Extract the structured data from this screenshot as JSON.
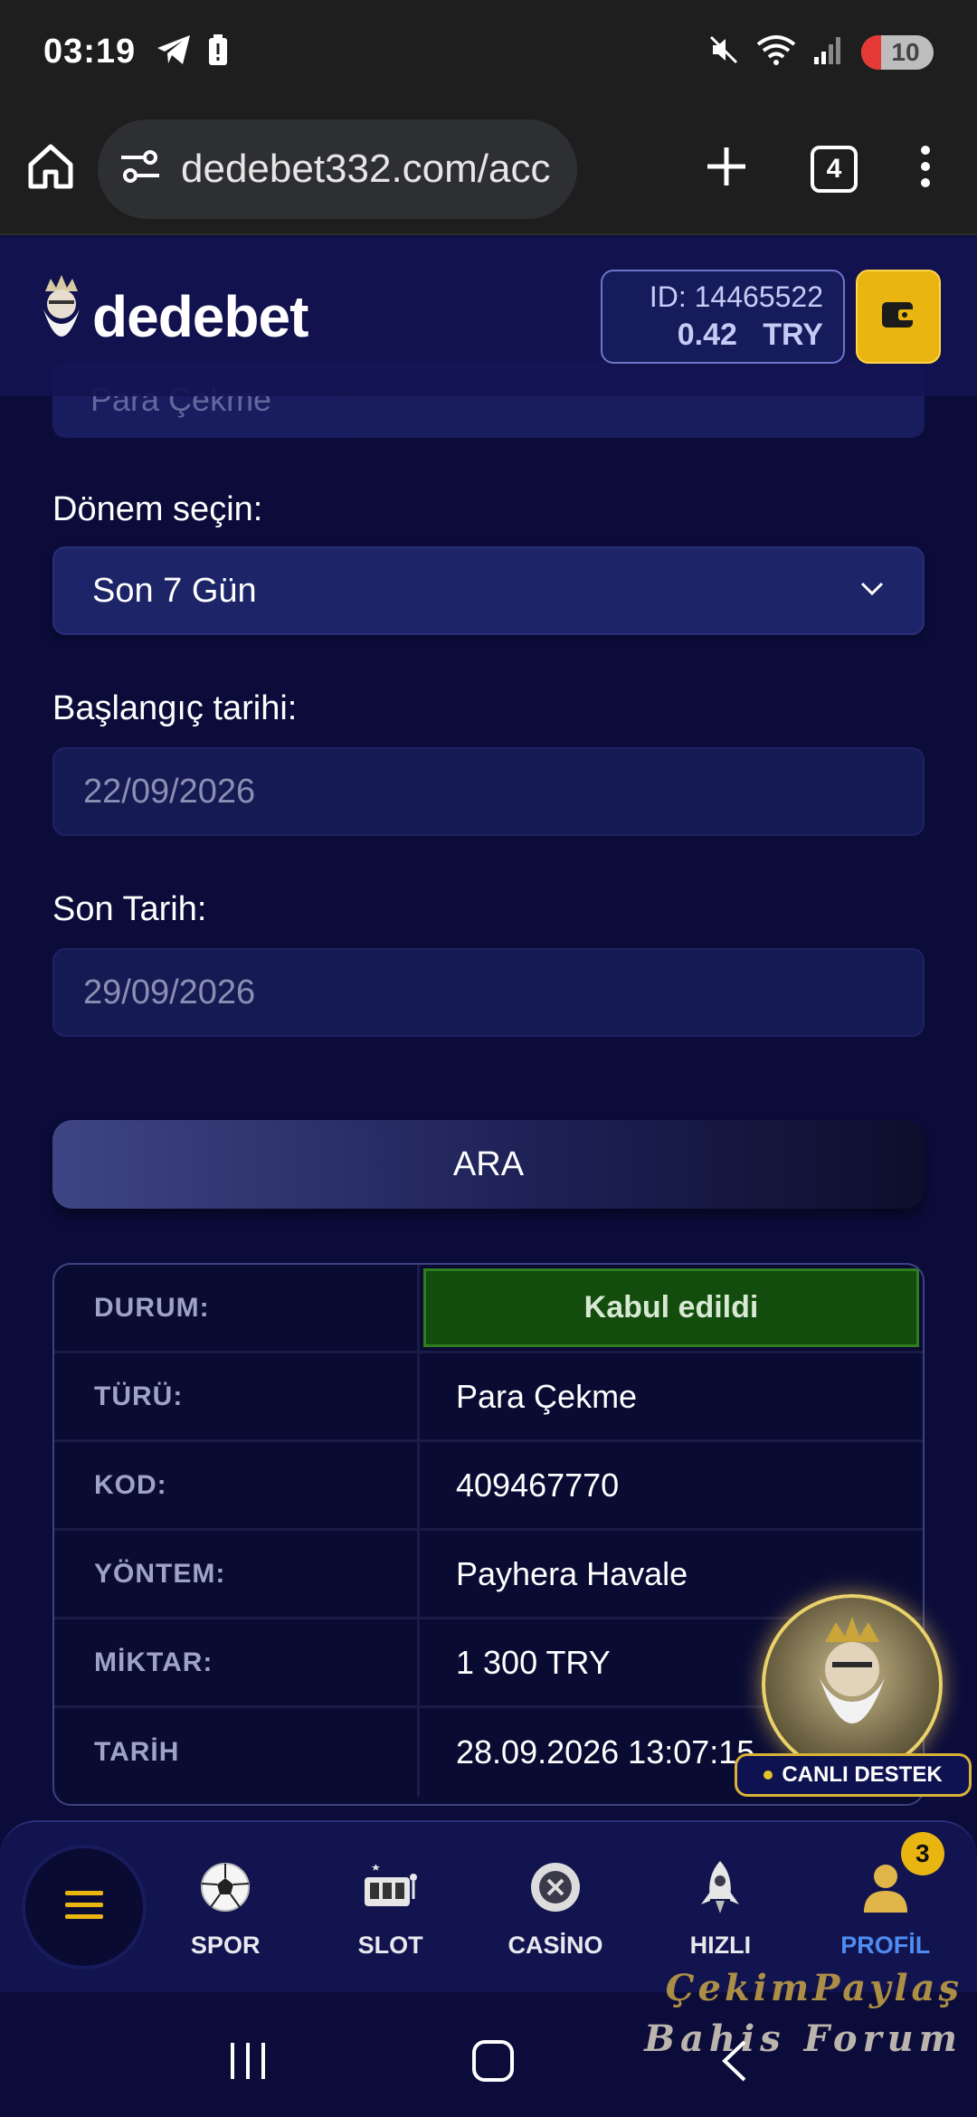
{
  "status_bar": {
    "time": "03:19",
    "battery": "10",
    "icons": [
      "telegram-icon",
      "alert-battery-icon",
      "mute-icon",
      "wifi-icon",
      "signal-icon"
    ]
  },
  "browser": {
    "url": "dedebet332.com/acc",
    "tab_count": "4"
  },
  "header": {
    "logo_text": "dedebet",
    "account_id": "ID: 14465522",
    "balance": "0.42",
    "currency": "TRY"
  },
  "form": {
    "type_value": "Para Çekme",
    "period_label": "Dönem seçin:",
    "period_value": "Son 7 Gün",
    "start_label": "Başlangıç tarihi:",
    "start_value": "22/09/2026",
    "end_label": "Son Tarih:",
    "end_value": "29/09/2026",
    "search_button": "ARA"
  },
  "result": {
    "rows": [
      {
        "key": "DURUM:",
        "value": "Kabul edildi"
      },
      {
        "key": "TÜRÜ:",
        "value": "Para Çekme"
      },
      {
        "key": "KOD:",
        "value": "409467770"
      },
      {
        "key": "YÖNTEM:",
        "value": "Payhera Havale"
      },
      {
        "key": "MİKTAR:",
        "value": "1 300 TRY"
      },
      {
        "key": "TARİH",
        "value": "28.09.2026 13:07:15"
      }
    ],
    "status_color": "#124d0e"
  },
  "support": {
    "label": "CANLI DESTEK"
  },
  "bottom_nav": {
    "items": [
      {
        "label": "SPOR",
        "icon": "soccer-ball-icon"
      },
      {
        "label": "SLOT",
        "icon": "slot-machine-icon"
      },
      {
        "label": "CASİNO",
        "icon": "casino-chip-icon"
      },
      {
        "label": "HIZLI",
        "icon": "rocket-icon"
      },
      {
        "label": "PROFİL",
        "icon": "user-icon"
      }
    ],
    "profile_badge": "3",
    "active_color": "#4f8bf0"
  },
  "watermark": {
    "line1": "ÇekimPaylaş",
    "line2": "Bahis Forum"
  }
}
